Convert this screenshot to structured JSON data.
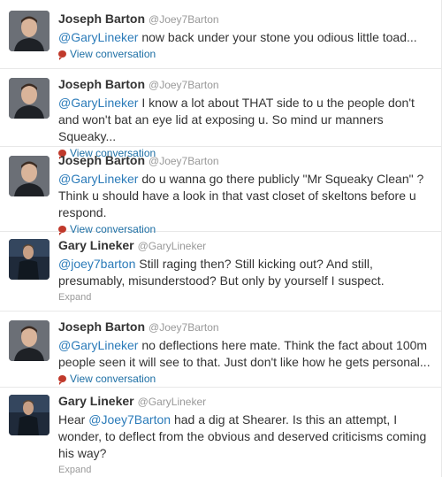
{
  "tweets": [
    {
      "name": "Joseph Barton",
      "handle": "@Joey7Barton",
      "avatar": "joey-avatar",
      "mention": "@GaryLineker",
      "text": " now back under your stone you odious little toad...",
      "action": "View conversation"
    },
    {
      "name": "Joseph Barton",
      "handle": "@Joey7Barton",
      "avatar": "joey-avatar",
      "mention": "@GaryLineker",
      "text": " I know a lot about THAT side to u the people don't and won't bat an eye lid at exposing u. So mind ur manners Squeaky...",
      "action": "View conversation"
    },
    {
      "name": "Joseph Barton",
      "handle": "@Joey7Barton",
      "avatar": "joey-avatar",
      "mention": "@GaryLineker",
      "text": " do u wanna go there publicly \"Mr Squeaky Clean\" ? Think u should have a look in that vast closet of skeltons before u respond.",
      "action": "View conversation"
    },
    {
      "name": "Gary Lineker",
      "handle": "@GaryLineker",
      "avatar": "gary-avatar",
      "mention": "@joey7barton",
      "text": " Still raging then? Still kicking out? And still, presumably, misunderstood? But only by yourself I suspect.",
      "action": "Expand"
    },
    {
      "name": "Joseph Barton",
      "handle": "@Joey7Barton",
      "avatar": "joey-avatar",
      "mention": "@GaryLineker",
      "text": " no deflections here mate. Think the fact about 100m people seen it will see to that. Just don't like how he gets personal...",
      "action": "View conversation"
    },
    {
      "name": "Gary Lineker",
      "handle": "@GaryLineker",
      "avatar": "gary-avatar",
      "prefix": "Hear ",
      "mention": "@Joey7Barton",
      "text": " had a dig at Shearer. Is this an attempt, I wonder, to deflect from the obvious and deserved criticisms coming his way?",
      "action": "Expand"
    }
  ],
  "colors": {
    "link": "#2b7bb9",
    "action_link": "#1d6fa5",
    "muted": "#999999",
    "bubble": "#c0392b"
  }
}
